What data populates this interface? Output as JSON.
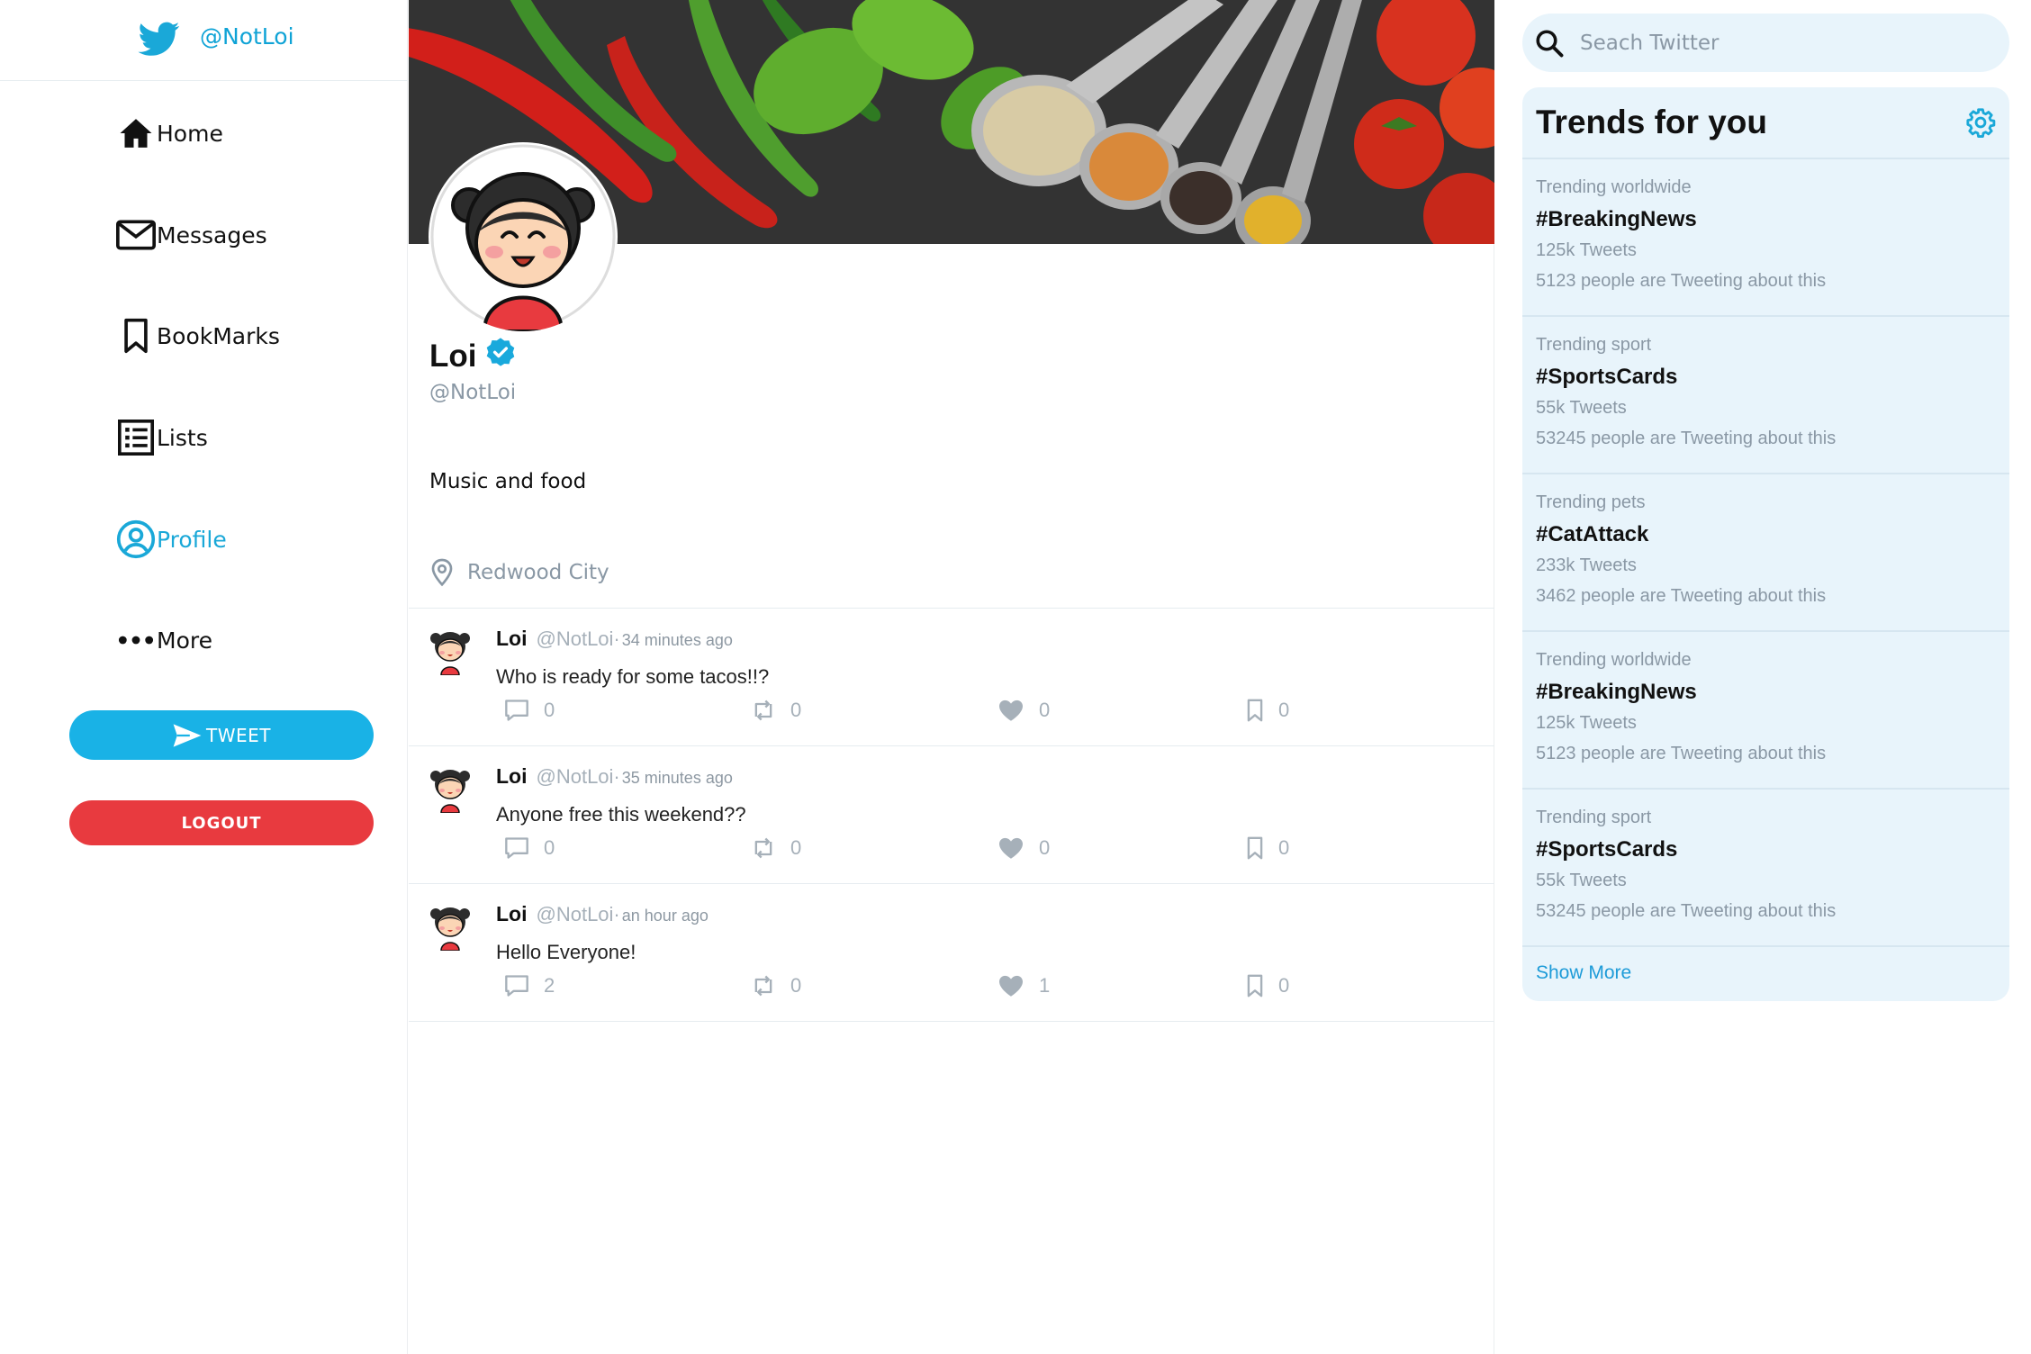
{
  "app": {
    "handle": "@NotLoi"
  },
  "nav": [
    {
      "id": "home",
      "label": "Home",
      "icon": "home-icon"
    },
    {
      "id": "messages",
      "label": "Messages",
      "icon": "mail-icon"
    },
    {
      "id": "bookmarks",
      "label": "BookMarks",
      "icon": "bookmark-icon"
    },
    {
      "id": "lists",
      "label": "Lists",
      "icon": "list-icon"
    },
    {
      "id": "profile",
      "label": "Profile",
      "icon": "user-circle-icon",
      "active": true
    },
    {
      "id": "more",
      "label": "More",
      "icon": "more-dots-icon"
    }
  ],
  "buttons": {
    "tweet": "TWEET",
    "logout": "LOGOUT"
  },
  "profile": {
    "name": "Loi",
    "handle": "@NotLoi",
    "bio": "Music and food",
    "location": "Redwood City",
    "verified": true
  },
  "tweets": [
    {
      "name": "Loi",
      "handle": "@NotLoi·",
      "time": "34 minutes ago",
      "text": "Who is ready for some tacos!!?",
      "replies": "0",
      "retweets": "0",
      "likes": "0",
      "bookmarks": "0"
    },
    {
      "name": "Loi",
      "handle": "@NotLoi·",
      "time": "35 minutes ago",
      "text": "Anyone free this weekend??",
      "replies": "0",
      "retweets": "0",
      "likes": "0",
      "bookmarks": "0"
    },
    {
      "name": "Loi",
      "handle": "@NotLoi·",
      "time": "an hour ago",
      "text": "Hello Everyone!",
      "replies": "2",
      "retweets": "0",
      "likes": "1",
      "bookmarks": "0"
    }
  ],
  "search": {
    "placeholder": "Seach Twitter"
  },
  "trends": {
    "title": "Trends for you",
    "items": [
      {
        "category": "Trending worldwide",
        "tag": "#BreakingNews",
        "count": "125k Tweets",
        "about": "5123 people are Tweeting about this"
      },
      {
        "category": "Trending sport",
        "tag": "#SportsCards",
        "count": "55k Tweets",
        "about": "53245 people are Tweeting about this"
      },
      {
        "category": "Trending pets",
        "tag": "#CatAttack",
        "count": "233k Tweets",
        "about": "3462 people are Tweeting about this"
      },
      {
        "category": "Trending worldwide",
        "tag": "#BreakingNews",
        "count": "125k Tweets",
        "about": "5123 people are Tweeting about this"
      },
      {
        "category": "Trending sport",
        "tag": "#SportsCards",
        "count": "55k Tweets",
        "about": "53245 people are Tweeting about this"
      }
    ],
    "show_more": "Show More"
  },
  "colors": {
    "accent": "#1aa8d8",
    "tweet_button": "#19b2e6",
    "logout_button": "#e83a3f",
    "panel": "#e8f4fb"
  }
}
